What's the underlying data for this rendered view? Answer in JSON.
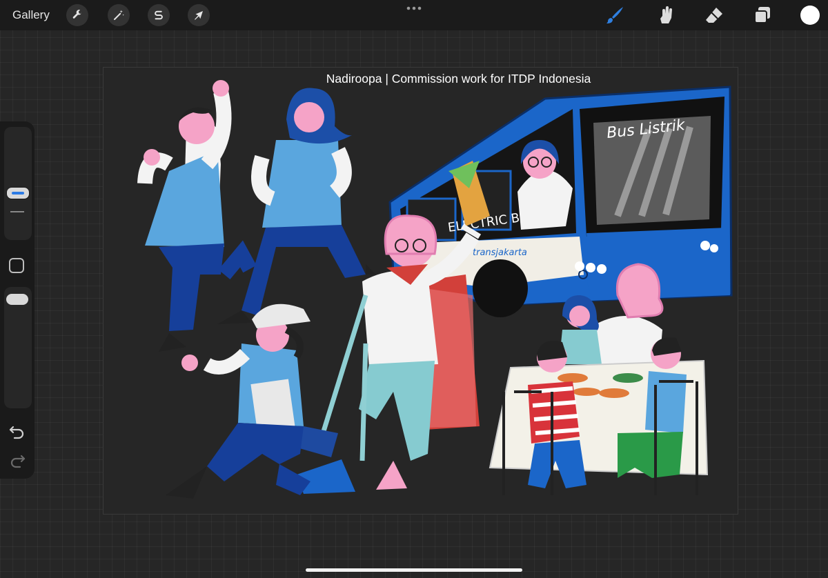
{
  "topbar": {
    "gallery_label": "Gallery",
    "left_tools": [
      {
        "icon": "wrench-icon",
        "name": "actions"
      },
      {
        "icon": "magic-wand-icon",
        "name": "adjustments"
      },
      {
        "icon": "selection-s-icon",
        "name": "selection"
      },
      {
        "icon": "arrow-cursor-icon",
        "name": "transform"
      }
    ],
    "more_icon": "ellipsis-icon",
    "right_tools": [
      {
        "icon": "brush-icon",
        "name": "paint",
        "active": true
      },
      {
        "icon": "smudge-icon",
        "name": "smudge"
      },
      {
        "icon": "eraser-icon",
        "name": "eraser"
      },
      {
        "icon": "layers-icon",
        "name": "layers"
      }
    ],
    "current_color": "#ffffff",
    "active_color": "#2f7fe0"
  },
  "sidebar": {
    "brush_size_slider": "brush-size",
    "modify_button": "modify-square-icon",
    "opacity_slider": "brush-opacity",
    "undo_icon": "undo-icon",
    "redo_icon": "redo-icon"
  },
  "canvas": {
    "caption": "Nadiroopa | Commission work for ITDP Indonesia",
    "bus_sign": "Bus Listrik",
    "bus_side_text": "ELECTRIC B",
    "bus_brand": "transjakarta"
  }
}
